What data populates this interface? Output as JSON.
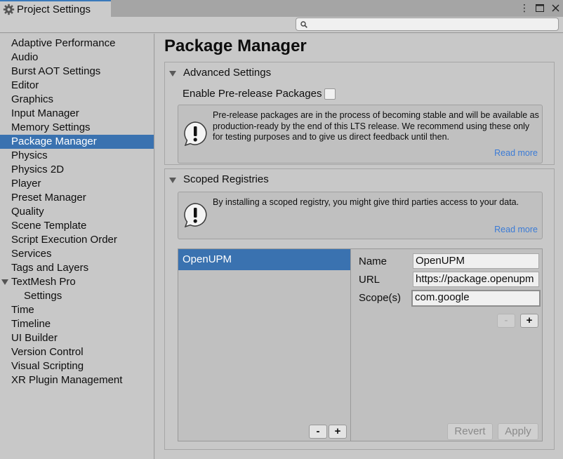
{
  "window": {
    "tab_title": "Project Settings",
    "icons": [
      "kebab-menu-icon",
      "maximize-icon",
      "close-icon"
    ]
  },
  "search": {
    "placeholder": ""
  },
  "sidebar": {
    "items": [
      {
        "label": "Adaptive Performance"
      },
      {
        "label": "Audio"
      },
      {
        "label": "Burst AOT Settings"
      },
      {
        "label": "Editor"
      },
      {
        "label": "Graphics"
      },
      {
        "label": "Input Manager"
      },
      {
        "label": "Memory Settings"
      },
      {
        "label": "Package Manager",
        "selected": true
      },
      {
        "label": "Physics"
      },
      {
        "label": "Physics 2D"
      },
      {
        "label": "Player"
      },
      {
        "label": "Preset Manager"
      },
      {
        "label": "Quality"
      },
      {
        "label": "Scene Template"
      },
      {
        "label": "Script Execution Order"
      },
      {
        "label": "Services"
      },
      {
        "label": "Tags and Layers"
      },
      {
        "label": "TextMesh Pro",
        "expanded": true
      },
      {
        "label": "Settings",
        "child": true
      },
      {
        "label": "Time"
      },
      {
        "label": "Timeline"
      },
      {
        "label": "UI Builder"
      },
      {
        "label": "Version Control"
      },
      {
        "label": "Visual Scripting"
      },
      {
        "label": "XR Plugin Management"
      }
    ]
  },
  "main": {
    "title": "Package Manager",
    "advanced": {
      "header": "Advanced Settings",
      "prerelease_label": "Enable Pre-release Packages",
      "prerelease_checked": false,
      "help_text": "Pre-release packages are in the process of becoming stable and will be available as production-ready by the end of this LTS release. We recommend using these only for testing purposes and to give us direct feedback until then.",
      "read_more": "Read more"
    },
    "scoped": {
      "header": "Scoped Registries",
      "help_text": "By installing a scoped registry, you might give third parties access to your data.",
      "read_more": "Read more",
      "registries": [
        "OpenUPM"
      ],
      "list_remove": "-",
      "list_add": "+",
      "name_label": "Name",
      "name_value": "OpenUPM",
      "url_label": "URL",
      "url_value": "https://package.openupm",
      "scope_label": "Scope(s)",
      "scope_value": "com.google",
      "scope_remove": "-",
      "scope_add": "+",
      "revert": "Revert",
      "apply": "Apply"
    }
  },
  "colors": {
    "selection": "#3a72b0",
    "link": "#3b7bd6",
    "panel": "#c8c8c8"
  }
}
